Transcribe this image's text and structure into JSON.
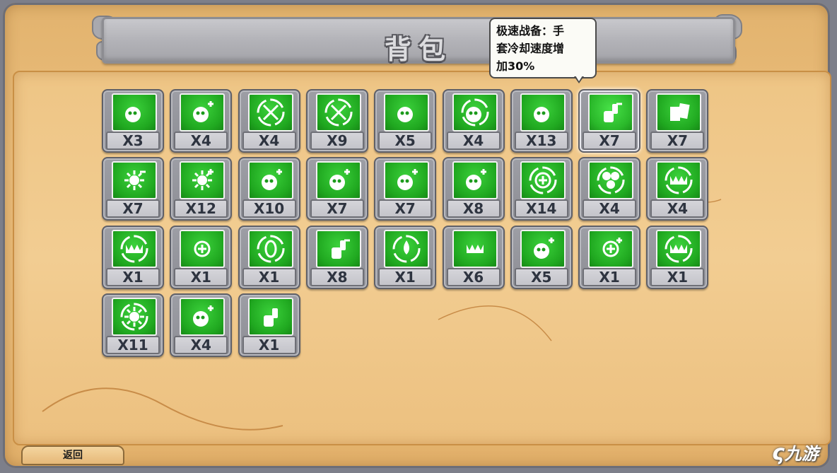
{
  "title": "背包",
  "tooltip": {
    "lines": [
      "极速战备：手",
      "套冷却速度增",
      "加30%"
    ]
  },
  "back_button": "返回",
  "watermark": "九游",
  "colors": {
    "icon_green": "#22a822",
    "slot_gray": "#9d9ea5",
    "parchment": "#ebbe7c"
  },
  "items": [
    {
      "icon": "spiral-seed-icon",
      "count": "X3"
    },
    {
      "icon": "creature-plus-icon",
      "count": "X4"
    },
    {
      "icon": "crosshair-ring-icon",
      "count": "X4"
    },
    {
      "icon": "cross-target-icon",
      "count": "X9"
    },
    {
      "icon": "dotted-seed-icon",
      "count": "X5"
    },
    {
      "icon": "cabbage-circle-icon",
      "count": "X4"
    },
    {
      "icon": "shield-creature-icon",
      "count": "X13"
    },
    {
      "icon": "glove-minus-icon",
      "count": "X7"
    },
    {
      "icon": "cards-icon",
      "count": "X7"
    },
    {
      "icon": "burst-minus-icon",
      "count": "X7"
    },
    {
      "icon": "burst-plus-icon",
      "count": "X12"
    },
    {
      "icon": "bomb-plus-icon",
      "count": "X10"
    },
    {
      "icon": "spiky-plus-icon",
      "count": "X7"
    },
    {
      "icon": "cactus-plus-icon",
      "count": "X7"
    },
    {
      "icon": "apple-plus-icon",
      "count": "X8"
    },
    {
      "icon": "heal-ring-icon",
      "count": "X14"
    },
    {
      "icon": "fan-ring-icon",
      "count": "X4"
    },
    {
      "icon": "jaws-ring-icon",
      "count": "X4"
    },
    {
      "icon": "jaws-circle-icon",
      "count": "X1"
    },
    {
      "icon": "heal-arrow-icon",
      "count": "X1"
    },
    {
      "icon": "zero-ring-icon",
      "count": "X1"
    },
    {
      "icon": "hammer-minus-icon",
      "count": "X8"
    },
    {
      "icon": "drop-ring-icon",
      "count": "X1"
    },
    {
      "icon": "jaws-drop-icon",
      "count": "X6"
    },
    {
      "icon": "twin-seed-plus-icon",
      "count": "X5"
    },
    {
      "icon": "heal-plus-icon",
      "count": "X1"
    },
    {
      "icon": "jaws-target-icon",
      "count": "X1"
    },
    {
      "icon": "sun-ring-icon",
      "count": "X11"
    },
    {
      "icon": "apple-plus-icon",
      "count": "X4"
    },
    {
      "icon": "tools-icon",
      "count": "X1"
    }
  ]
}
